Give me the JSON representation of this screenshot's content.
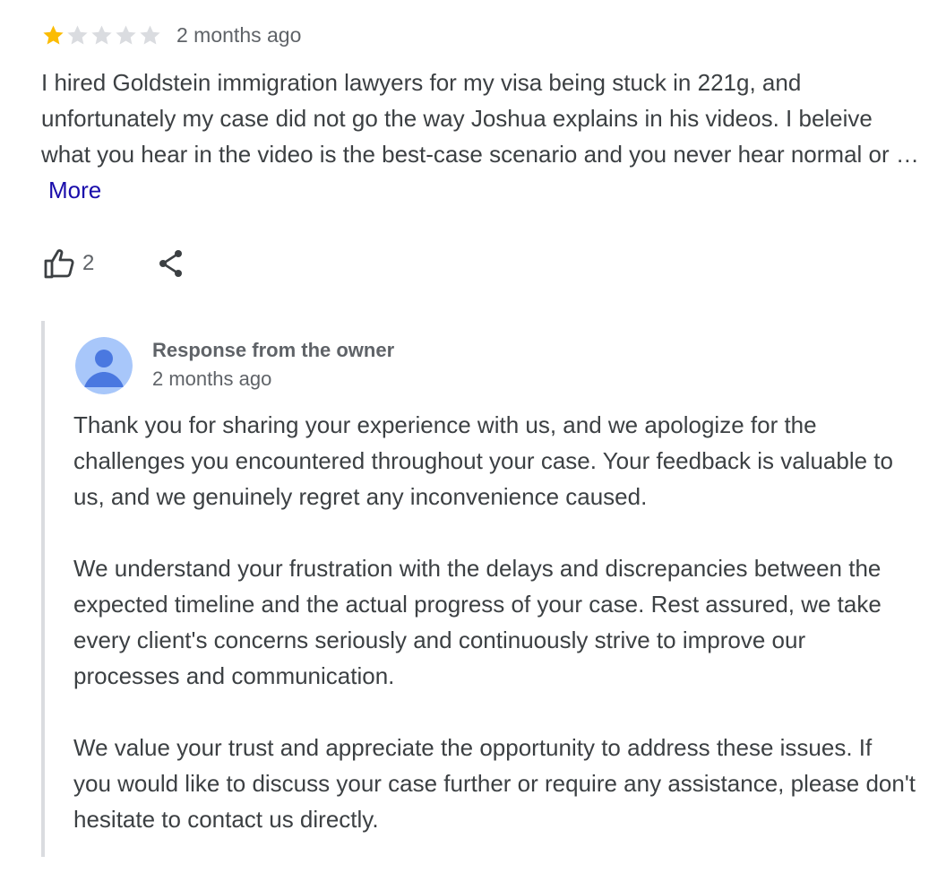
{
  "review": {
    "rating": 1,
    "rating_max": 5,
    "star_filled_color": "#fbbc04",
    "star_empty_color": "#dadce0",
    "date": "2 months ago",
    "text": "I hired Goldstein immigration lawyers for my visa being stuck in 221g, and unfortunately my case did not go the way Joshua explains in his videos. I beleive what you hear in the video is the best-case scenario and you never hear normal or …",
    "more_label": "More",
    "like_count": "2",
    "like_icon": "thumb-up-icon",
    "share_icon": "share-icon"
  },
  "owner_response": {
    "title": "Response from the owner",
    "date": "2 months ago",
    "avatar_icon": "person-avatar-icon",
    "paragraphs": [
      "Thank you for sharing your experience with us, and we apologize for the challenges you encountered throughout your case. Your feedback is valuable to us, and we genuinely regret any inconvenience caused.",
      "We understand your frustration with the delays and discrepancies between the expected timeline and the actual progress of your case. Rest assured, we take every client's concerns seriously and continuously strive to improve our processes and communication.",
      "We value your trust and appreciate the opportunity to address these issues. If you would like to discuss your case further or require any assistance, please don't hesitate to contact us directly."
    ]
  }
}
